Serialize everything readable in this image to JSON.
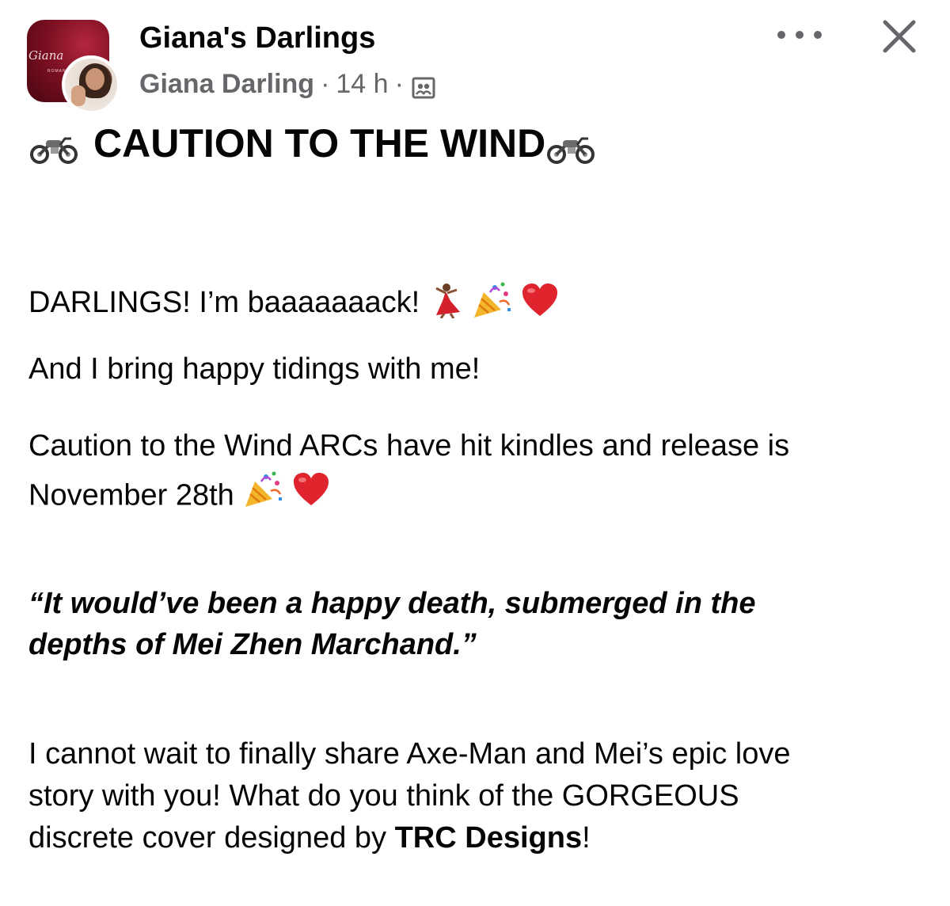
{
  "post": {
    "group_name": "Giana's Darlings",
    "author": "Giana Darling",
    "separator": "·",
    "time": "14 h",
    "audience_icon": "group-audience-icon",
    "group_avatar_text": "Giana",
    "title": "CAUTION TO THE WIND",
    "title_icon": "motorcycle-icon",
    "lines": {
      "greeting": "DARLINGS! I’m baaaaaaack!",
      "tidings": "And I bring happy tidings with me!",
      "arcs_1": "Caution to the Wind ARCs have hit kindles and release is",
      "arcs_2": "November 28th"
    },
    "quote": {
      "line1": "“It would’ve been a happy death, submerged in the",
      "line2": "depths of Mei Zhen Marchand.”"
    },
    "closing": {
      "line1": "I cannot wait to finally share Axe-Man and Mei’s epic love",
      "line2": "story with you! What do you think of the GORGEOUS",
      "line3_prefix": "discrete cover designed by ",
      "line3_bold": "TRC Designs",
      "line3_suffix": "!"
    }
  },
  "icons": {
    "more": "more-options-icon",
    "close": "close-icon",
    "dancer": "dancer-emoji",
    "party": "party-popper-emoji",
    "heart": "red-heart-emoji"
  },
  "colors": {
    "text": "#050505",
    "secondary": "#65676b",
    "heart": "#e0242e"
  }
}
